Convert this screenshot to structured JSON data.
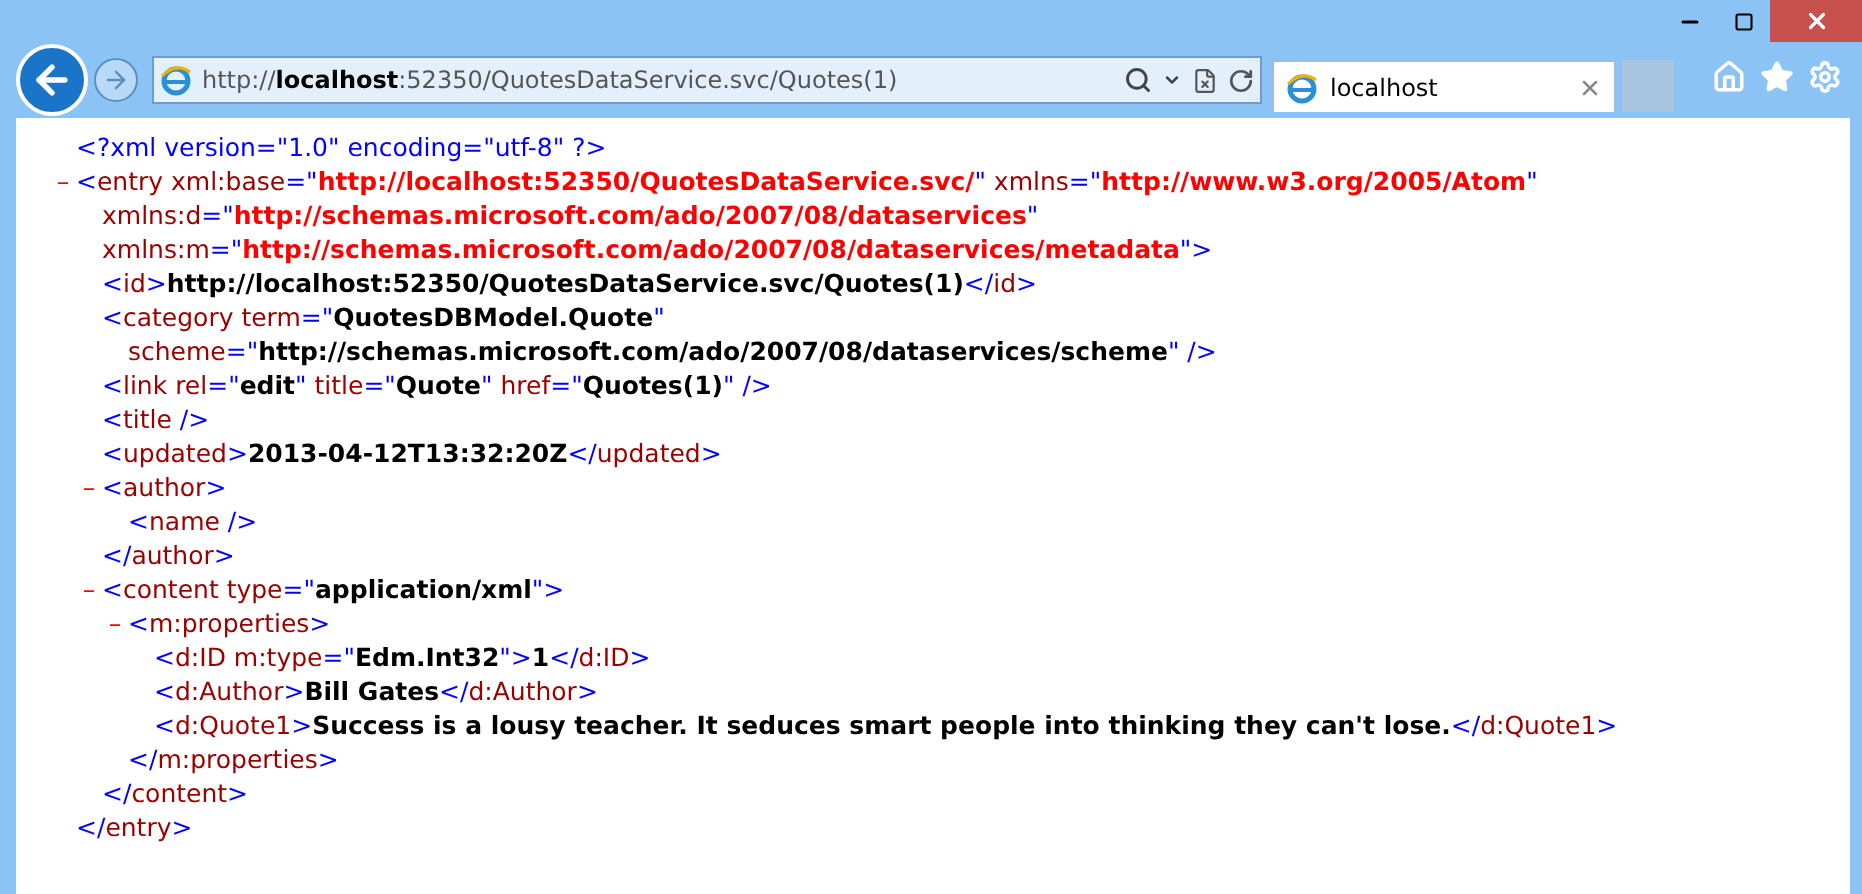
{
  "browser": {
    "address": "http://**localhost**:52350/QuotesDataService.svc/Quotes(1)",
    "tabs": [
      {
        "title": "localhost",
        "selected": true
      }
    ]
  },
  "xml": [
    {
      "lines": [
        [
          {
            "kind": "p",
            "text": "<?xml version=\"1.0\" encoding=\"utf-8\" ?>"
          }
        ]
      ]
    },
    {
      "toggle": "–",
      "lines": [
        [
          {
            "kind": "p",
            "text": "<"
          },
          {
            "kind": "n",
            "text": "entry xml:base"
          },
          {
            "kind": "p",
            "text": "=\""
          },
          {
            "kind": "r",
            "text": "http://localhost:52350/QuotesDataService.svc/"
          },
          {
            "kind": "p",
            "text": "\""
          },
          {
            "kind": "n",
            "text": " xmlns"
          },
          {
            "kind": "p",
            "text": "=\""
          },
          {
            "kind": "r",
            "text": "http://www.w3.org/2005/Atom"
          },
          {
            "kind": "p",
            "text": "\""
          }
        ],
        [
          {
            "kind": "n",
            "text": "xmlns:d"
          },
          {
            "kind": "p",
            "text": "=\""
          },
          {
            "kind": "r",
            "text": "http://schemas.microsoft.com/ado/2007/08/dataservices"
          },
          {
            "kind": "p",
            "text": "\""
          }
        ],
        [
          {
            "kind": "n",
            "text": "xmlns:m"
          },
          {
            "kind": "p",
            "text": "=\""
          },
          {
            "kind": "r",
            "text": "http://schemas.microsoft.com/ado/2007/08/dataservices/metadata"
          },
          {
            "kind": "p",
            "text": "\">"
          }
        ]
      ],
      "children": [
        {
          "lines": [
            [
              {
                "kind": "p",
                "text": "<"
              },
              {
                "kind": "n",
                "text": "id"
              },
              {
                "kind": "p",
                "text": ">"
              },
              {
                "kind": "v",
                "text": "http://localhost:52350/QuotesDataService.svc/Quotes(1)"
              },
              {
                "kind": "p",
                "text": "</"
              },
              {
                "kind": "n",
                "text": "id"
              },
              {
                "kind": "p",
                "text": ">"
              }
            ]
          ]
        },
        {
          "lines": [
            [
              {
                "kind": "p",
                "text": "<"
              },
              {
                "kind": "n",
                "text": "category term"
              },
              {
                "kind": "p",
                "text": "=\""
              },
              {
                "kind": "v",
                "text": "QuotesDBModel.Quote"
              },
              {
                "kind": "p",
                "text": "\""
              }
            ],
            [
              {
                "kind": "n",
                "text": "scheme"
              },
              {
                "kind": "p",
                "text": "=\""
              },
              {
                "kind": "v",
                "text": "http://schemas.microsoft.com/ado/2007/08/dataservices/scheme"
              },
              {
                "kind": "p",
                "text": "\" />"
              }
            ]
          ]
        },
        {
          "lines": [
            [
              {
                "kind": "p",
                "text": "<"
              },
              {
                "kind": "n",
                "text": "link rel"
              },
              {
                "kind": "p",
                "text": "=\""
              },
              {
                "kind": "v",
                "text": "edit"
              },
              {
                "kind": "p",
                "text": "\""
              },
              {
                "kind": "n",
                "text": " title"
              },
              {
                "kind": "p",
                "text": "=\""
              },
              {
                "kind": "v",
                "text": "Quote"
              },
              {
                "kind": "p",
                "text": "\""
              },
              {
                "kind": "n",
                "text": " href"
              },
              {
                "kind": "p",
                "text": "=\""
              },
              {
                "kind": "v",
                "text": "Quotes(1)"
              },
              {
                "kind": "p",
                "text": "\" />"
              }
            ]
          ]
        },
        {
          "lines": [
            [
              {
                "kind": "p",
                "text": "<"
              },
              {
                "kind": "n",
                "text": "title"
              },
              {
                "kind": "p",
                "text": " />"
              }
            ]
          ]
        },
        {
          "lines": [
            [
              {
                "kind": "p",
                "text": "<"
              },
              {
                "kind": "n",
                "text": "updated"
              },
              {
                "kind": "p",
                "text": ">"
              },
              {
                "kind": "v",
                "text": "2013-04-12T13:32:20Z"
              },
              {
                "kind": "p",
                "text": "</"
              },
              {
                "kind": "n",
                "text": "updated"
              },
              {
                "kind": "p",
                "text": ">"
              }
            ]
          ]
        },
        {
          "toggle": "–",
          "lines": [
            [
              {
                "kind": "p",
                "text": "<"
              },
              {
                "kind": "n",
                "text": "author"
              },
              {
                "kind": "p",
                "text": ">"
              }
            ]
          ],
          "children": [
            {
              "lines": [
                [
                  {
                    "kind": "p",
                    "text": "<"
                  },
                  {
                    "kind": "n",
                    "text": "name"
                  },
                  {
                    "kind": "p",
                    "text": " />"
                  }
                ]
              ]
            }
          ],
          "end": [
            {
              "kind": "p",
              "text": "</"
            },
            {
              "kind": "n",
              "text": "author"
            },
            {
              "kind": "p",
              "text": ">"
            }
          ]
        },
        {
          "toggle": "–",
          "lines": [
            [
              {
                "kind": "p",
                "text": "<"
              },
              {
                "kind": "n",
                "text": "content type"
              },
              {
                "kind": "p",
                "text": "=\""
              },
              {
                "kind": "v",
                "text": "application/xml"
              },
              {
                "kind": "p",
                "text": "\">"
              }
            ]
          ],
          "children": [
            {
              "toggle": "–",
              "lines": [
                [
                  {
                    "kind": "p",
                    "text": "<"
                  },
                  {
                    "kind": "n",
                    "text": "m:properties"
                  },
                  {
                    "kind": "p",
                    "text": ">"
                  }
                ]
              ],
              "children": [
                {
                  "lines": [
                    [
                      {
                        "kind": "p",
                        "text": "<"
                      },
                      {
                        "kind": "n",
                        "text": "d:ID m:type"
                      },
                      {
                        "kind": "p",
                        "text": "=\""
                      },
                      {
                        "kind": "v",
                        "text": "Edm.Int32"
                      },
                      {
                        "kind": "p",
                        "text": "\">"
                      },
                      {
                        "kind": "v",
                        "text": "1"
                      },
                      {
                        "kind": "p",
                        "text": "</"
                      },
                      {
                        "kind": "n",
                        "text": "d:ID"
                      },
                      {
                        "kind": "p",
                        "text": ">"
                      }
                    ]
                  ]
                },
                {
                  "lines": [
                    [
                      {
                        "kind": "p",
                        "text": "<"
                      },
                      {
                        "kind": "n",
                        "text": "d:Author"
                      },
                      {
                        "kind": "p",
                        "text": ">"
                      },
                      {
                        "kind": "v",
                        "text": "Bill Gates"
                      },
                      {
                        "kind": "p",
                        "text": "</"
                      },
                      {
                        "kind": "n",
                        "text": "d:Author"
                      },
                      {
                        "kind": "p",
                        "text": ">"
                      }
                    ]
                  ]
                },
                {
                  "lines": [
                    [
                      {
                        "kind": "p",
                        "text": "<"
                      },
                      {
                        "kind": "n",
                        "text": "d:Quote1"
                      },
                      {
                        "kind": "p",
                        "text": ">"
                      },
                      {
                        "kind": "v",
                        "text": "Success is a lousy teacher. It seduces smart people into thinking they can't lose."
                      },
                      {
                        "kind": "p",
                        "text": "</"
                      },
                      {
                        "kind": "n",
                        "text": "d:Quote1"
                      },
                      {
                        "kind": "p",
                        "text": ">"
                      }
                    ]
                  ]
                }
              ],
              "end": [
                {
                  "kind": "p",
                  "text": "</"
                },
                {
                  "kind": "n",
                  "text": "m:properties"
                },
                {
                  "kind": "p",
                  "text": ">"
                }
              ]
            }
          ],
          "end": [
            {
              "kind": "p",
              "text": "</"
            },
            {
              "kind": "n",
              "text": "content"
            },
            {
              "kind": "p",
              "text": ">"
            }
          ]
        }
      ],
      "end": [
        {
          "kind": "p",
          "text": "</"
        },
        {
          "kind": "n",
          "text": "entry"
        },
        {
          "kind": "p",
          "text": ">"
        }
      ]
    }
  ]
}
